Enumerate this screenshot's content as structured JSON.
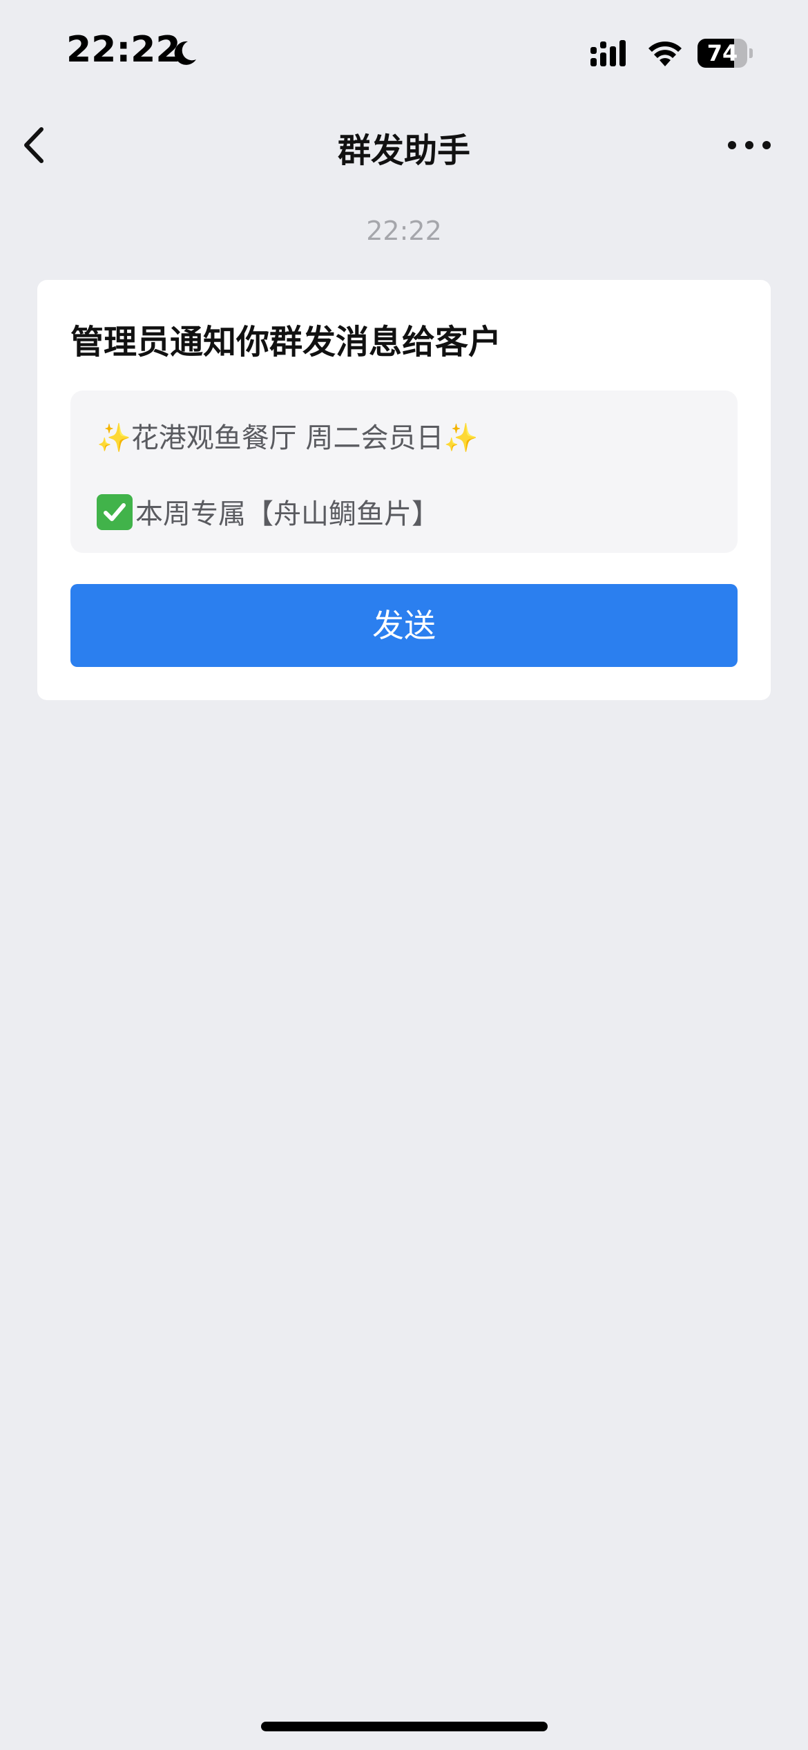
{
  "status_bar": {
    "time": "22:22",
    "battery_level": 74,
    "icons": [
      "moon-icon",
      "signal-icon",
      "wifi-icon",
      "battery-icon"
    ]
  },
  "nav": {
    "title": "群发助手",
    "back_icon": "chevron-left-icon",
    "more_icon": "more-dots-icon"
  },
  "message": {
    "time": "22:22",
    "card_title": "管理员通知你群发消息给客户",
    "preview": {
      "line1_sparkle_left": "✨",
      "line1_text": "花港观鱼餐厅 周二会员日",
      "line1_sparkle_right": "✨",
      "line2_check_icon": "check-mark-icon",
      "line2_text": "本周专属【舟山鲷鱼片】"
    },
    "send_label": "发送"
  },
  "colors": {
    "background": "#ecedf1",
    "card": "#ffffff",
    "preview_bg": "#f5f5f7",
    "accent": "#2b7fef",
    "check": "#41b34a",
    "sparkle": "#f2c230"
  }
}
